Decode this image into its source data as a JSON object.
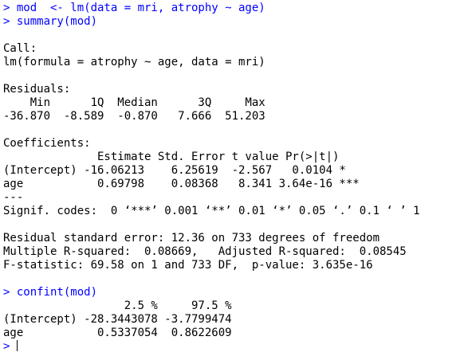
{
  "console": {
    "lines": [
      {
        "type": "input",
        "text": "> mod  <- lm(data = mri, atrophy ~ age)"
      },
      {
        "type": "input",
        "text": "> summary(mod)"
      },
      {
        "type": "blank",
        "text": ""
      },
      {
        "type": "output",
        "text": "Call:"
      },
      {
        "type": "output",
        "text": "lm(formula = atrophy ~ age, data = mri)"
      },
      {
        "type": "blank",
        "text": ""
      },
      {
        "type": "output",
        "text": "Residuals:"
      },
      {
        "type": "output",
        "text": "    Min      1Q  Median      3Q     Max "
      },
      {
        "type": "output",
        "text": "-36.870  -8.589  -0.870   7.666  51.203 "
      },
      {
        "type": "blank",
        "text": ""
      },
      {
        "type": "output",
        "text": "Coefficients:"
      },
      {
        "type": "output",
        "text": "              Estimate Std. Error t value Pr(>|t|)    "
      },
      {
        "type": "output",
        "text": "(Intercept) -16.06213    6.25619  -2.567   0.0104 *  "
      },
      {
        "type": "output",
        "text": "age           0.69798    0.08368   8.341 3.64e-16 ***"
      },
      {
        "type": "output",
        "text": "---"
      },
      {
        "type": "output",
        "text": "Signif. codes:  0 ‘***’ 0.001 ‘**’ 0.01 ‘*’ 0.05 ‘.’ 0.1 ‘ ’ 1"
      },
      {
        "type": "blank",
        "text": ""
      },
      {
        "type": "output",
        "text": "Residual standard error: 12.36 on 733 degrees of freedom"
      },
      {
        "type": "output",
        "text": "Multiple R-squared:  0.08669,\tAdjusted R-squared:  0.08545 "
      },
      {
        "type": "output",
        "text": "F-statistic: 69.58 on 1 and 733 DF,  p-value: 3.635e-16"
      },
      {
        "type": "blank",
        "text": ""
      },
      {
        "type": "input",
        "text": "> confint(mod)"
      },
      {
        "type": "output",
        "text": "                  2.5 %     97.5 %"
      },
      {
        "type": "output",
        "text": "(Intercept) -28.3443078 -3.7799474"
      },
      {
        "type": "output",
        "text": "age           0.5337054  0.8622609"
      }
    ],
    "prompt": {
      "type": "input",
      "text": "> "
    }
  }
}
